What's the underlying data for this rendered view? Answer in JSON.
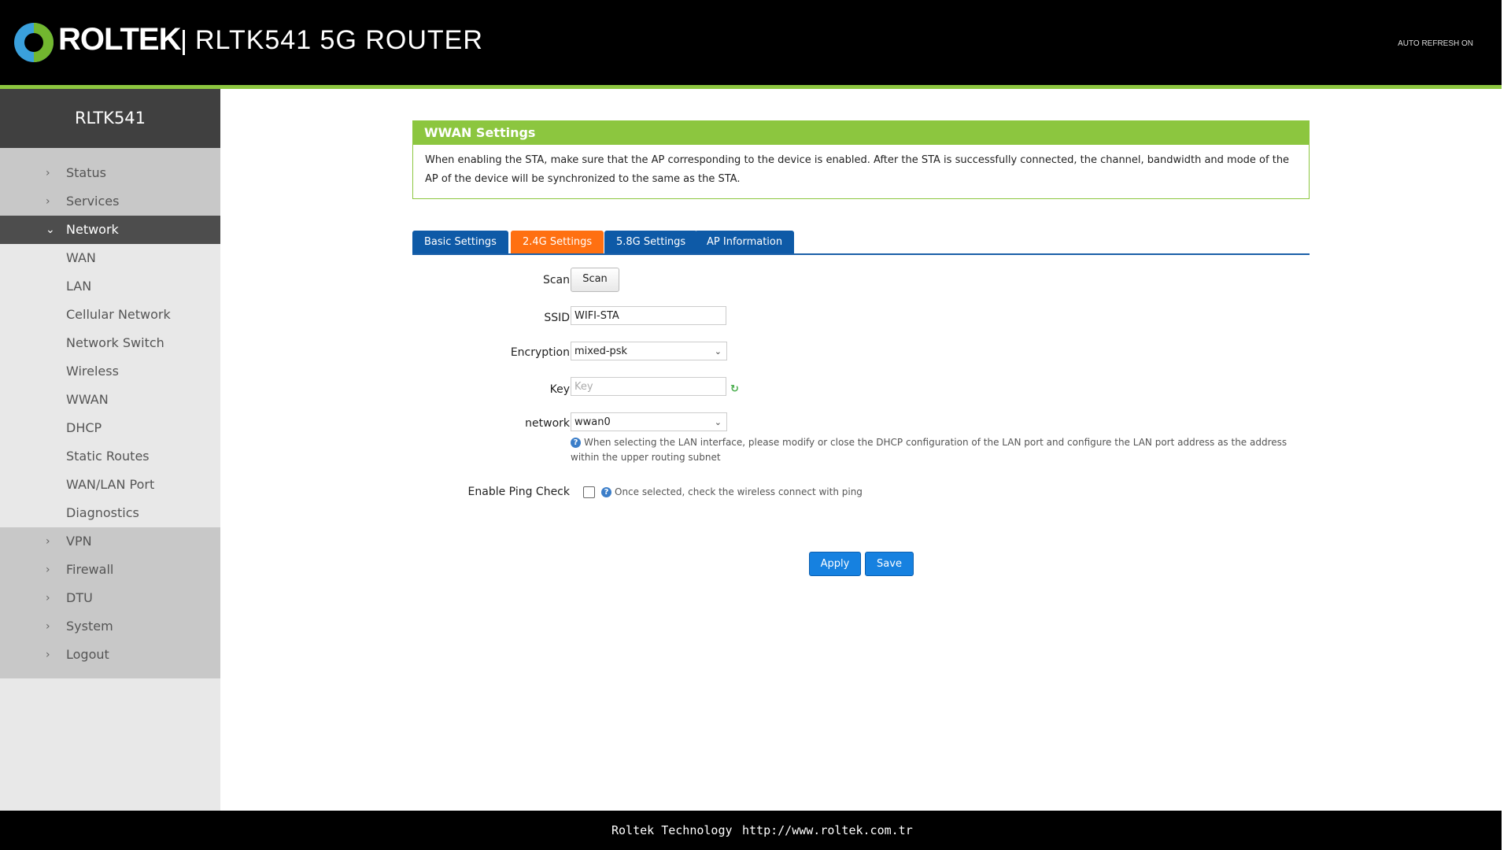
{
  "header": {
    "brand": "ROLTEK",
    "title": "RLTK541  5G  ROUTER",
    "auto_refresh": "AUTO REFRESH ON"
  },
  "sidebar": {
    "device": "RLTK541",
    "top_items": [
      {
        "label": "Status"
      },
      {
        "label": "Services"
      },
      {
        "label": "Network"
      }
    ],
    "network_sub": [
      {
        "label": "WAN"
      },
      {
        "label": "LAN"
      },
      {
        "label": "Cellular Network"
      },
      {
        "label": "Network Switch"
      },
      {
        "label": "Wireless"
      },
      {
        "label": "WWAN"
      },
      {
        "label": "DHCP"
      },
      {
        "label": "Static Routes"
      },
      {
        "label": "WAN/LAN Port"
      },
      {
        "label": "Diagnostics"
      }
    ],
    "bottom_items": [
      {
        "label": "VPN"
      },
      {
        "label": "Firewall"
      },
      {
        "label": "DTU"
      },
      {
        "label": "System"
      },
      {
        "label": "Logout"
      }
    ]
  },
  "card": {
    "title": "WWAN Settings",
    "description": "When enabling the STA, make sure that the AP corresponding to the device is enabled. After the STA is successfully connected, the channel, bandwidth and mode of the AP of the device will be synchronized to the same as the STA."
  },
  "tabs": [
    {
      "label": "Basic Settings"
    },
    {
      "label": "2.4G Settings"
    },
    {
      "label": "5.8G Settings"
    },
    {
      "label": "AP Information"
    }
  ],
  "form": {
    "scan_label": "Scan",
    "scan_button": "Scan",
    "ssid_label": "SSID",
    "ssid_value": "WIFI-STA",
    "encryption_label": "Encryption",
    "encryption_value": "mixed-psk",
    "key_label": "Key",
    "key_placeholder": "Key",
    "network_label": "network",
    "network_value": "wwan0",
    "network_hint": "When selecting the LAN interface, please modify or close the DHCP configuration of the LAN port and configure the LAN port address as the address within the upper routing subnet",
    "ping_label": "Enable Ping Check",
    "ping_hint": "Once selected, check the wireless connect with ping",
    "ping_checked": false
  },
  "actions": {
    "apply": "Apply",
    "save": "Save"
  },
  "footer": {
    "company": "Roltek Technology",
    "url": "http://www.roltek.com.tr"
  },
  "colors": {
    "accent_green": "#8cc63f",
    "tab_blue": "#0e5aa7",
    "tab_active_orange": "#ff7011",
    "button_blue": "#1681e0"
  }
}
